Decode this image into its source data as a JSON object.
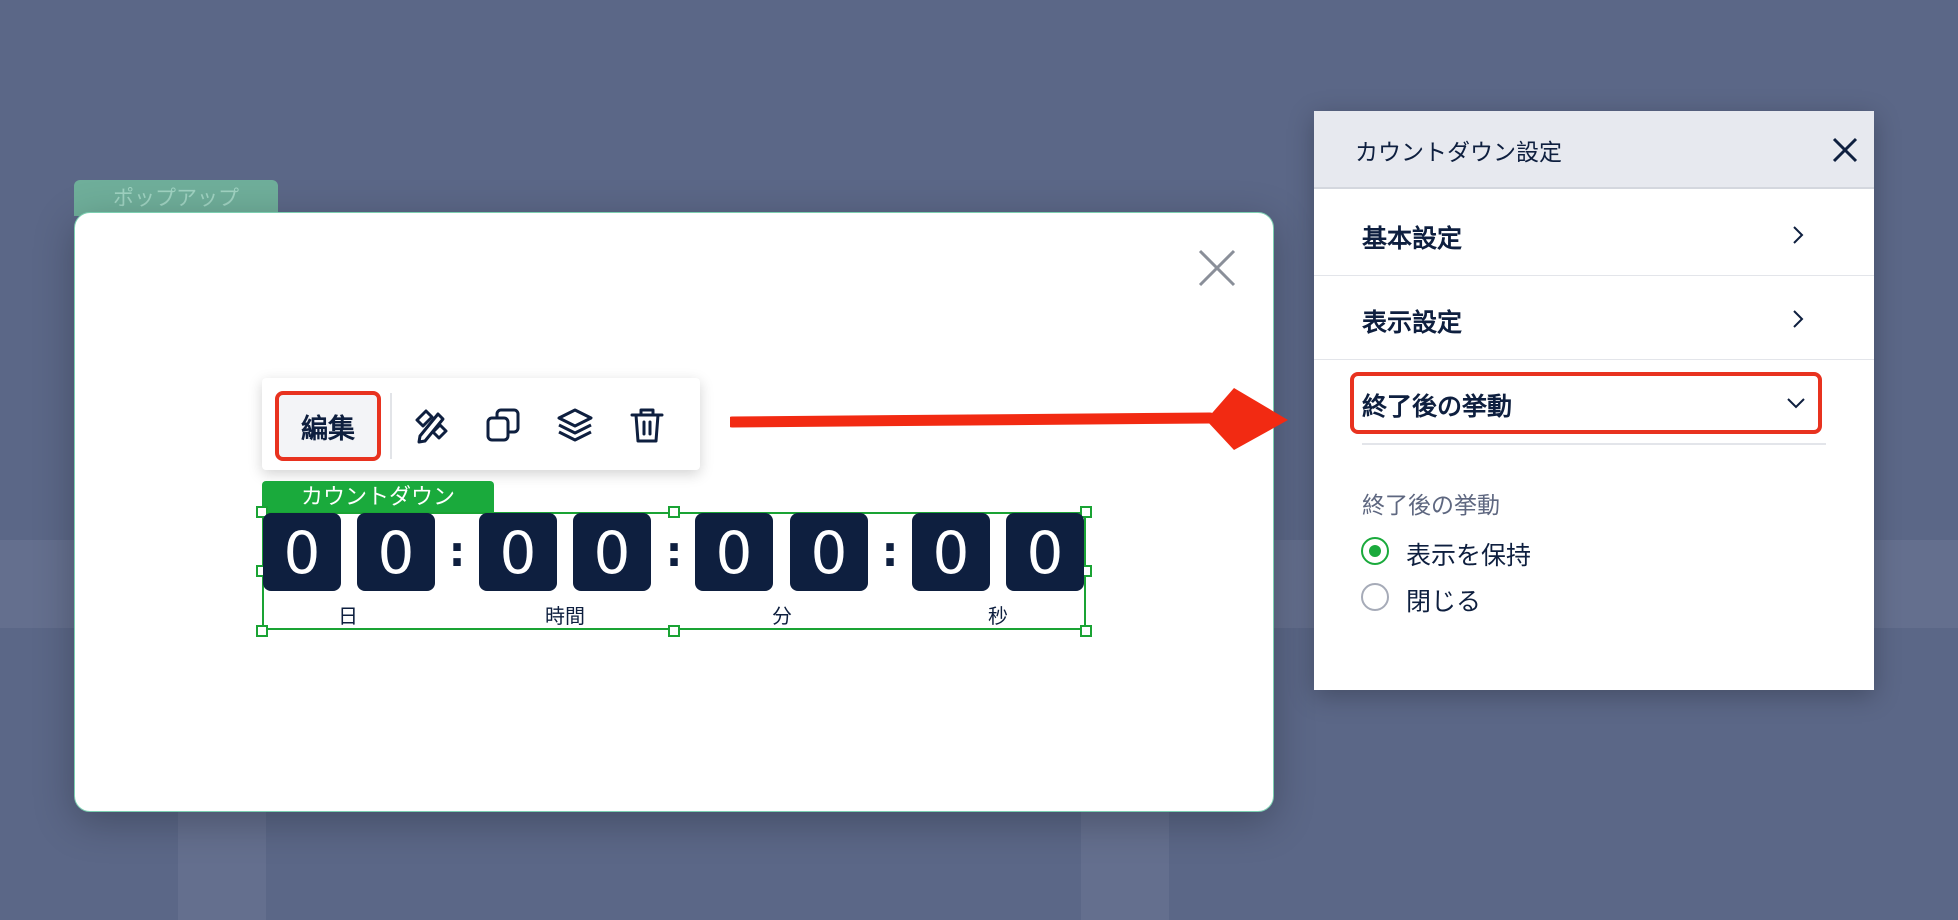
{
  "popup": {
    "tab_label": "ポップアップ"
  },
  "toolbar": {
    "edit_label": "編集"
  },
  "countdown": {
    "label": "カウントダウン",
    "digits": [
      "0",
      "0",
      "0",
      "0",
      "0",
      "0",
      "0",
      "0"
    ],
    "separator": ":",
    "units": [
      "日",
      "時間",
      "分",
      "秒"
    ]
  },
  "panel": {
    "title": "カウントダウン設定",
    "rows": [
      {
        "label": "基本設定"
      },
      {
        "label": "表示設定"
      },
      {
        "label": "終了後の挙動"
      }
    ],
    "section_label": "終了後の挙動",
    "options": [
      {
        "label": "表示を保持",
        "selected": true
      },
      {
        "label": "閉じる",
        "selected": false
      }
    ]
  },
  "colors": {
    "background": "#5b6787",
    "digit_bg": "#0e1f3f",
    "accent_green": "#1aaa3c",
    "highlight_red": "#e8321f"
  }
}
